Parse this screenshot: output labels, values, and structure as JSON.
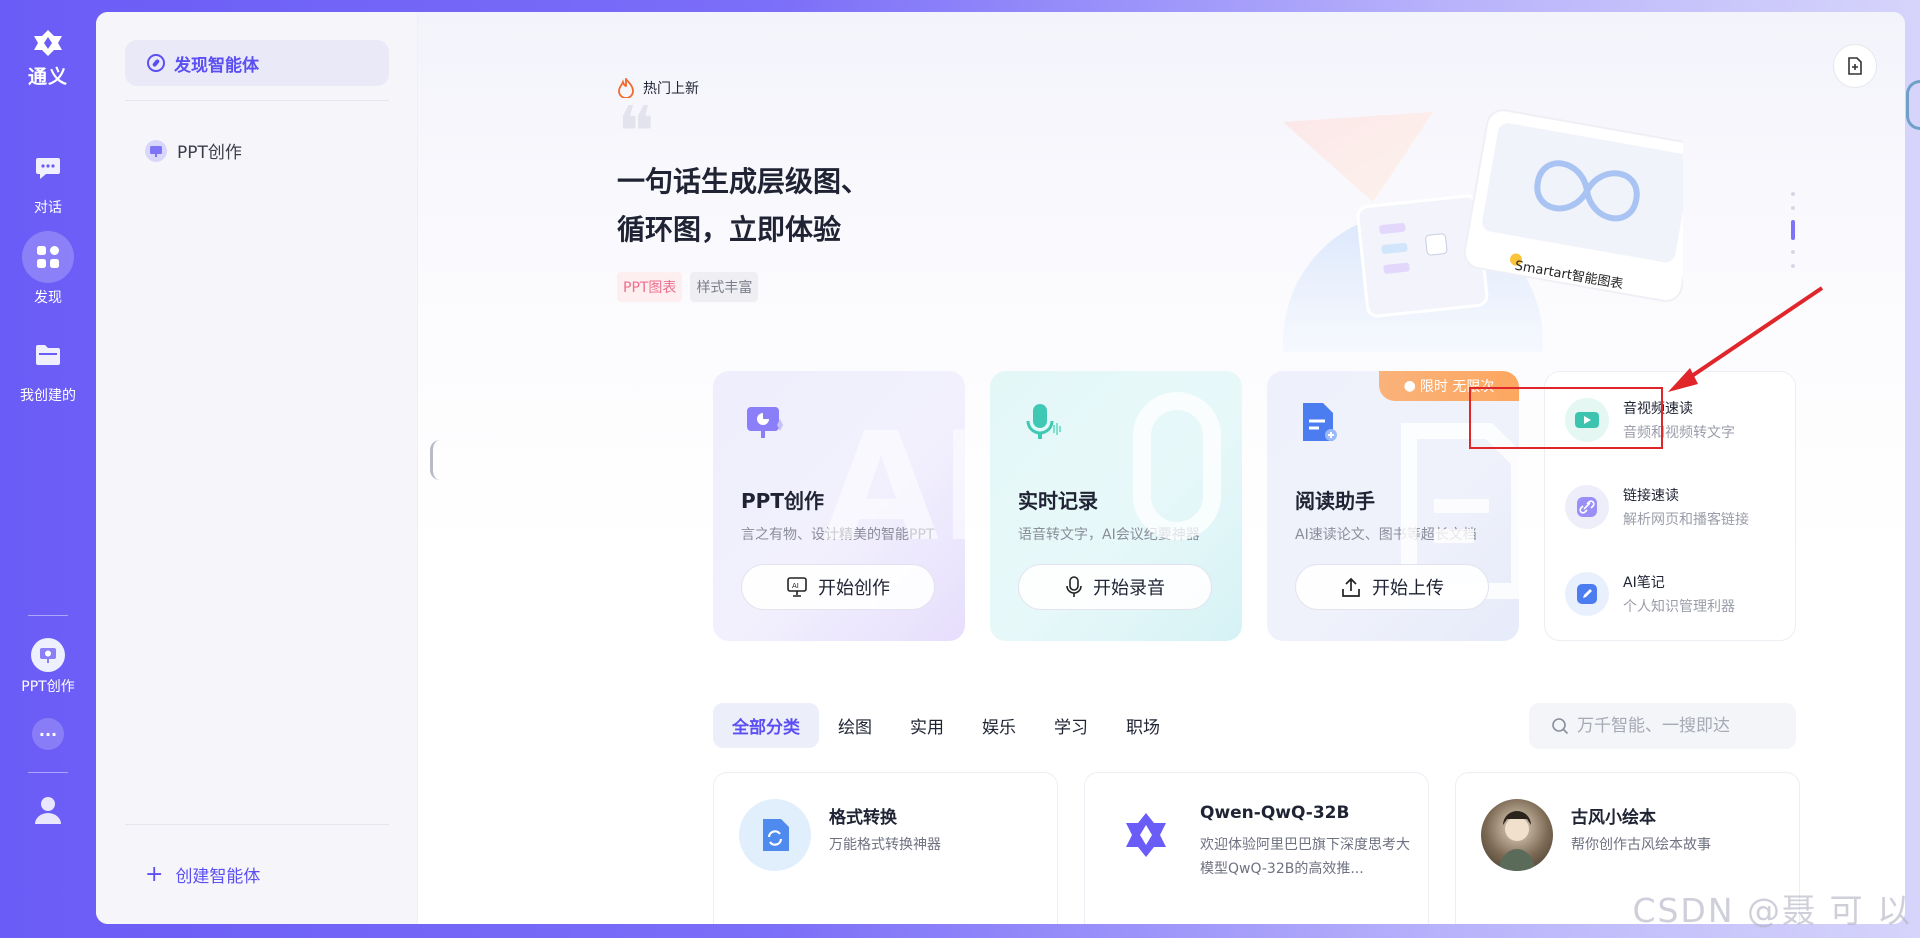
{
  "rail": {
    "logo_text": "通义",
    "items": [
      {
        "label": "对话"
      },
      {
        "label": "发现"
      },
      {
        "label": "我创建的"
      }
    ],
    "recent_label": "PPT创作"
  },
  "sidebar": {
    "active": "发现智能体",
    "items": [
      {
        "label": "PPT创作"
      }
    ],
    "create_label": "创建智能体"
  },
  "hero": {
    "hot_label": "热门上新",
    "title_line1": "一句话生成层级图、",
    "title_line2": "循环图，立即体验",
    "tags": [
      "PPT图表",
      "样式丰富"
    ],
    "art_caption": "Smartart智能图表"
  },
  "feature_cards": [
    {
      "title": "PPT创作",
      "desc": "言之有物、设计精美的智能PPT",
      "button": "开始创作"
    },
    {
      "title": "实时记录",
      "desc": "语音转文字，AI会议纪要神器",
      "button": "开始录音"
    },
    {
      "title": "阅读助手",
      "desc": "AI速读论文、图书等超长文档",
      "button": "开始上传",
      "badge": "限时 无限次"
    }
  ],
  "mini_tools": [
    {
      "title": "音视频速读",
      "desc": "音频和视频转文字"
    },
    {
      "title": "链接速读",
      "desc": "解析网页和播客链接"
    },
    {
      "title": "AI笔记",
      "desc": "个人知识管理利器"
    }
  ],
  "tabs": [
    "全部分类",
    "绘图",
    "实用",
    "娱乐",
    "学习",
    "职场"
  ],
  "search": {
    "placeholder": "万千智能、一搜即达"
  },
  "agents": [
    {
      "title": "格式转换",
      "desc": "万能格式转换神器"
    },
    {
      "title": "Qwen-QwQ-32B",
      "desc": "欢迎体验阿里巴巴旗下深度思考大模型QwQ-32B的高效推..."
    },
    {
      "title": "古风小绘本",
      "desc": "帮你创作古风绘本故事"
    }
  ],
  "watermark": "CSDN @聂 可 以",
  "colors": {
    "accent": "#5b4ff3",
    "rail": "#6a5cf6",
    "highlight": "#e0262b"
  }
}
